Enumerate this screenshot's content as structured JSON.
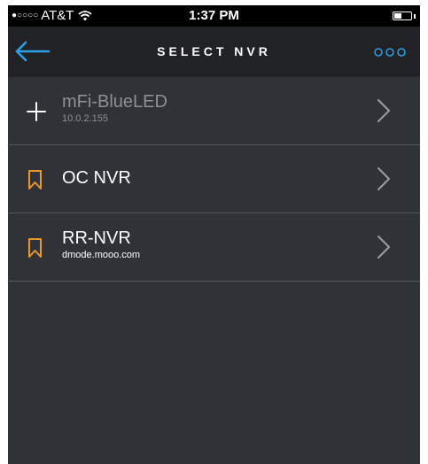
{
  "status_bar": {
    "signal": "●○○○○",
    "carrier": "AT&T",
    "time": "1:37 PM",
    "wifi_icon": "wifi-icon",
    "battery_icon": "battery-icon"
  },
  "nav": {
    "title": "SELECT NVR",
    "back_icon": "arrow-left-icon",
    "more_icon": "more-dots-icon"
  },
  "colors": {
    "background": "#2f3237",
    "nav_background": "#202226",
    "accent_blue": "#2ea0e6",
    "bookmark_orange": "#e8982e",
    "dim_text": "#8d9095",
    "divider": "#53575d"
  },
  "nvr_list": [
    {
      "name": "mFi-BlueLED",
      "subtitle": "10.0.2.155",
      "icon": "plus-icon",
      "dimmed": true
    },
    {
      "name": "OC NVR",
      "subtitle": "",
      "icon": "bookmark-icon",
      "dimmed": false
    },
    {
      "name": "RR-NVR",
      "subtitle": "dmode.mooo.com",
      "icon": "bookmark-icon",
      "dimmed": false
    }
  ]
}
